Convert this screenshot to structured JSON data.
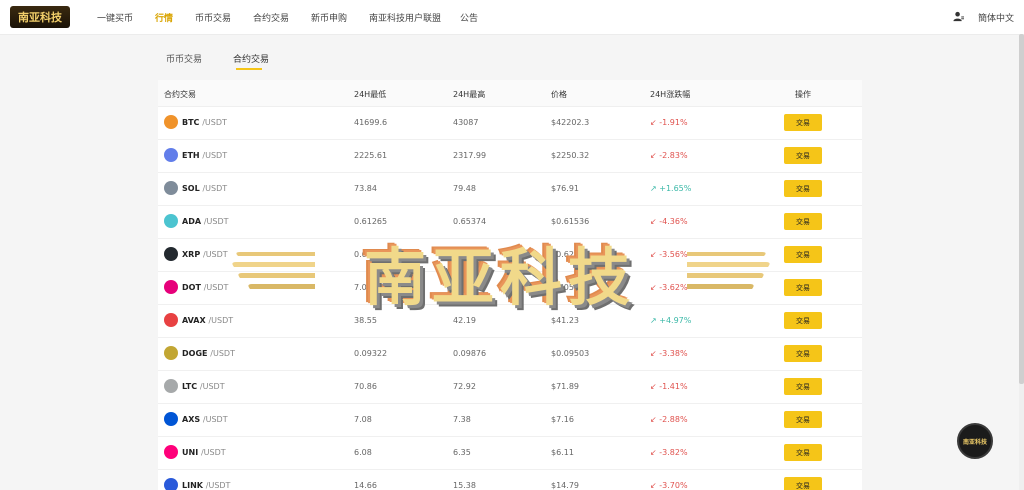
{
  "brand": {
    "logo_text": "南亚科技"
  },
  "nav": {
    "items": [
      {
        "label": "一键买币"
      },
      {
        "label": "行情"
      },
      {
        "label": "币币交易"
      },
      {
        "label": "合约交易"
      },
      {
        "label": "新币申购"
      },
      {
        "label": "南亚科技用户联盟"
      },
      {
        "label": "公告"
      }
    ],
    "active_index": 1,
    "language": "簡体中文"
  },
  "subtabs": [
    {
      "label": "币币交易"
    },
    {
      "label": "合约交易"
    }
  ],
  "table": {
    "headers": [
      "合约交易",
      "24H最低",
      "24H最高",
      "价格",
      "24H涨跌幅",
      "操作"
    ],
    "trade_label": "交易",
    "rows": [
      {
        "symbol": "BTC",
        "pair": "/USDT",
        "low": "41699.6",
        "high": "43087",
        "price": "$42202.3",
        "change": "-1.91%",
        "dir": "down",
        "icon_color": "#f0932b",
        "icon": "btc-icon"
      },
      {
        "symbol": "ETH",
        "pair": "/USDT",
        "low": "2225.61",
        "high": "2317.99",
        "price": "$2250.32",
        "change": "-2.83%",
        "dir": "down",
        "icon_color": "#627eea",
        "icon": "eth-icon"
      },
      {
        "symbol": "SOL",
        "pair": "/USDT",
        "low": "73.84",
        "high": "79.48",
        "price": "$76.91",
        "change": "+1.65%",
        "dir": "up",
        "icon_color": "#7f8c9a",
        "icon": "sol-icon"
      },
      {
        "symbol": "ADA",
        "pair": "/USDT",
        "low": "0.61265",
        "high": "0.65374",
        "price": "$0.61536",
        "change": "-4.36%",
        "dir": "down",
        "icon_color": "#4cc4d0",
        "icon": "ada-icon"
      },
      {
        "symbol": "XRP",
        "pair": "/USDT",
        "low": "0.6196",
        "high": "0.64472",
        "price": "$0.62133",
        "change": "-3.56%",
        "dir": "down",
        "icon_color": "#23292f",
        "icon": "xrp-icon"
      },
      {
        "symbol": "DOT",
        "pair": "/USDT",
        "low": "7.03",
        "high": "7.36",
        "price": "$7.05",
        "change": "-3.62%",
        "dir": "down",
        "icon_color": "#e6007a",
        "icon": "dot-icon"
      },
      {
        "symbol": "AVAX",
        "pair": "/USDT",
        "low": "38.55",
        "high": "42.19",
        "price": "$41.23",
        "change": "+4.97%",
        "dir": "up",
        "icon_color": "#e84142",
        "icon": "avax-icon"
      },
      {
        "symbol": "DOGE",
        "pair": "/USDT",
        "low": "0.09322",
        "high": "0.09876",
        "price": "$0.09503",
        "change": "-3.38%",
        "dir": "down",
        "icon_color": "#c2a633",
        "icon": "doge-icon"
      },
      {
        "symbol": "LTC",
        "pair": "/USDT",
        "low": "70.86",
        "high": "72.92",
        "price": "$71.89",
        "change": "-1.41%",
        "dir": "down",
        "icon_color": "#a6a9aa",
        "icon": "ltc-icon"
      },
      {
        "symbol": "AXS",
        "pair": "/USDT",
        "low": "7.08",
        "high": "7.38",
        "price": "$7.16",
        "change": "-2.88%",
        "dir": "down",
        "icon_color": "#0055d5",
        "icon": "axs-icon"
      },
      {
        "symbol": "UNI",
        "pair": "/USDT",
        "low": "6.08",
        "high": "6.35",
        "price": "$6.11",
        "change": "-3.82%",
        "dir": "down",
        "icon_color": "#ff007a",
        "icon": "uni-icon"
      },
      {
        "symbol": "LINK",
        "pair": "/USDT",
        "low": "14.66",
        "high": "15.38",
        "price": "$14.79",
        "change": "-3.70%",
        "dir": "down",
        "icon_color": "#2a5ada",
        "icon": "link-icon"
      }
    ]
  },
  "watermark": {
    "text": "南亚科技"
  },
  "float_avatar": {
    "text": "南亚科技"
  },
  "colors": {
    "accent": "#f5c518",
    "up": "#3cb9a8",
    "down": "#e0534f"
  }
}
